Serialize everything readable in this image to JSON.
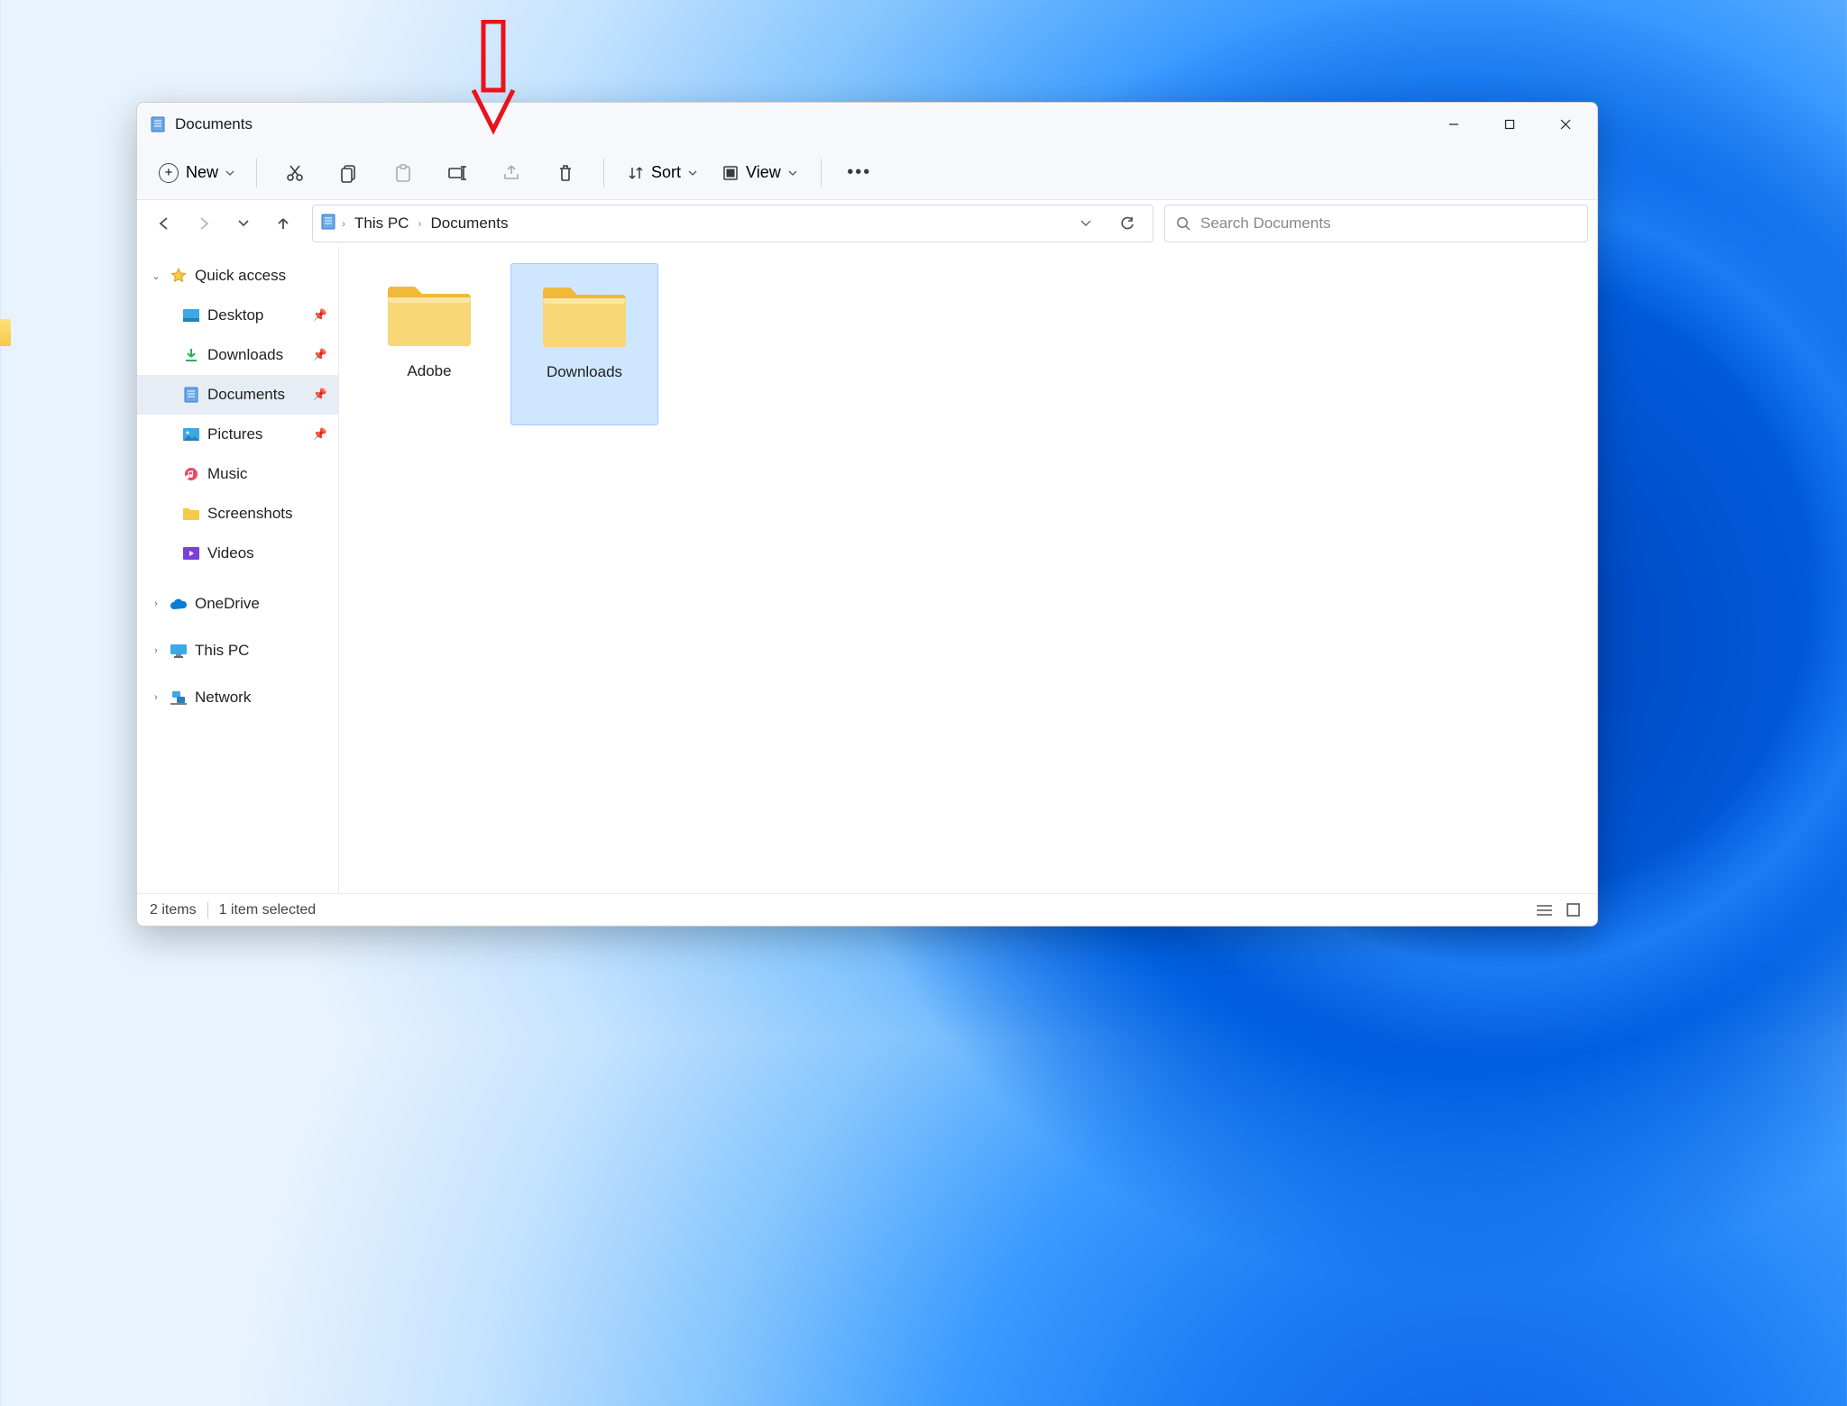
{
  "window": {
    "title": "Documents"
  },
  "toolbar": {
    "new_label": "New",
    "sort_label": "Sort",
    "view_label": "View"
  },
  "breadcrumb": {
    "root": "This PC",
    "current": "Documents"
  },
  "search": {
    "placeholder": "Search Documents"
  },
  "sidebar": {
    "quick_access": "Quick access",
    "items": [
      {
        "label": "Desktop",
        "pinned": true
      },
      {
        "label": "Downloads",
        "pinned": true
      },
      {
        "label": "Documents",
        "pinned": true,
        "active": true
      },
      {
        "label": "Pictures",
        "pinned": true
      },
      {
        "label": "Music",
        "pinned": false
      },
      {
        "label": "Screenshots",
        "pinned": false
      },
      {
        "label": "Videos",
        "pinned": false
      }
    ],
    "onedrive": "OneDrive",
    "this_pc": "This PC",
    "network": "Network"
  },
  "folders": [
    {
      "label": "Adobe",
      "selected": false
    },
    {
      "label": "Downloads",
      "selected": true
    }
  ],
  "status": {
    "count": "2 items",
    "selected": "1 item selected"
  }
}
